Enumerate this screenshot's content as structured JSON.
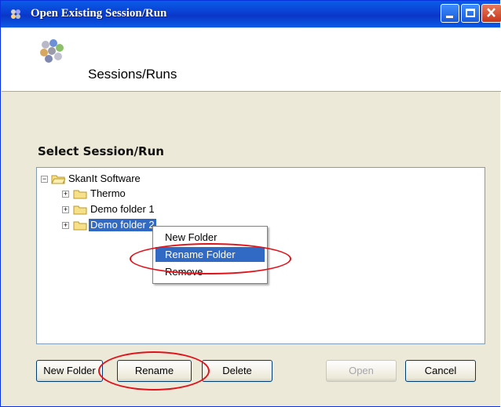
{
  "window": {
    "title": "Open Existing Session/Run",
    "controls": {
      "minimize": "minimize-icon",
      "maximize": "maximize-icon",
      "close": "close-icon"
    }
  },
  "header": {
    "title": "Sessions/Runs",
    "icon": "sessions-cluster-icon"
  },
  "select_label": "Select Session/Run",
  "tree": {
    "root": {
      "label": "SkanIt Software",
      "expander": "−"
    },
    "children": [
      {
        "label": "Thermo",
        "expander": "+"
      },
      {
        "label": "Demo folder 1",
        "expander": "+"
      },
      {
        "label": "Demo folder 2",
        "expander": "+",
        "selected": true
      }
    ]
  },
  "context_menu": {
    "items": [
      {
        "label": "New Folder"
      },
      {
        "label": "Rename Folder",
        "highlighted": true
      },
      {
        "label": "Remove"
      }
    ]
  },
  "buttons": {
    "new_folder": "New Folder",
    "rename": "Rename",
    "delete": "Delete",
    "open": "Open",
    "cancel": "Cancel"
  },
  "colors": {
    "titlebar": "#0a5ce8",
    "selection": "#316ac5",
    "annotation": "#e2121a",
    "dialog_bg": "#ece9d8"
  }
}
